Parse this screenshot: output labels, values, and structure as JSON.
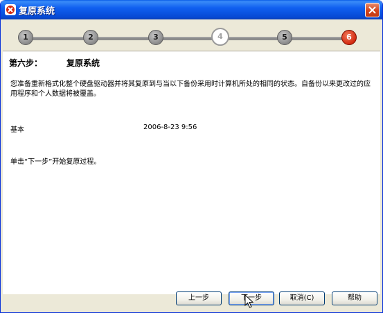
{
  "window": {
    "title": "复原系统",
    "close_label": "×"
  },
  "steps": [
    {
      "label": "1",
      "state": "done"
    },
    {
      "label": "2",
      "state": "done"
    },
    {
      "label": "3",
      "state": "done"
    },
    {
      "label": "4",
      "state": "current"
    },
    {
      "label": "5",
      "state": "done"
    },
    {
      "label": "6",
      "state": "final"
    }
  ],
  "page": {
    "step_heading": "第六步：",
    "step_title": "复原系统",
    "description": "您准备重新格式化整个硬盘驱动器并将其复原到与当以下备份采用时计算机所处的相同的状态。自备份以来更改过的应用程序和个人数据将被覆盖。",
    "backup": {
      "name": "基本",
      "date": "2006-8-23 9:56"
    },
    "instruction": "单击“下一步”开始复原过程。"
  },
  "buttons": {
    "back": "上一步",
    "next": "下一步",
    "cancel": "取消(C)",
    "help": "帮助"
  },
  "colors": {
    "titlebar": "#0a5ee8",
    "final_step": "#d42a10",
    "dialog_bg": "#ece9d8"
  }
}
